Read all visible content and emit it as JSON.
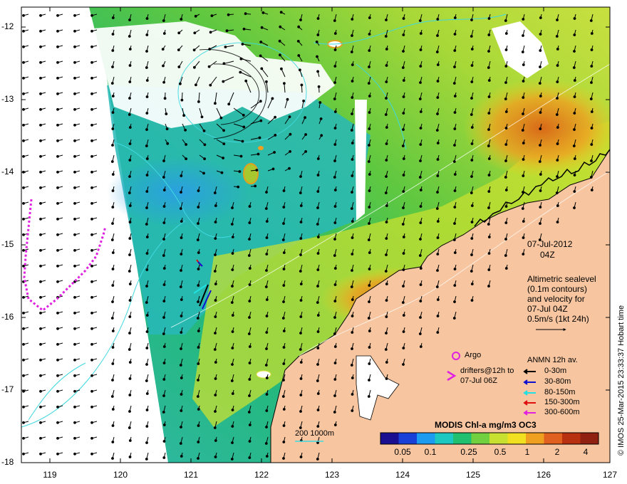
{
  "axes": {
    "y_ticks": [
      "-12",
      "-13",
      "-14",
      "-15",
      "-16",
      "-17",
      "-18"
    ],
    "x_ticks": [
      "119",
      "120",
      "121",
      "122",
      "123",
      "124",
      "125",
      "126",
      "127"
    ],
    "lon_range": [
      118.7,
      127
    ],
    "lat_range": [
      -18,
      -11.7
    ]
  },
  "date_block": {
    "date": "07-Jul-2012",
    "time": "04Z"
  },
  "altimetry_note": [
    "Altimetric sealevel",
    "(0.1m contours)",
    "and velocity for",
    "07-Jul 04Z",
    "0.5m/s (1kt 24h)"
  ],
  "argo_label": "Argo",
  "drifters_label": [
    "drifters@12h to",
    "07-Jul 06Z"
  ],
  "anmn": {
    "title": "ANMN 12h av.",
    "entries": [
      {
        "label": "0-30m",
        "color": "#000000"
      },
      {
        "label": "30-80m",
        "color": "#1010d0"
      },
      {
        "label": "80-150m",
        "color": "#20e0e0"
      },
      {
        "label": "150-300m",
        "color": "#e01010"
      },
      {
        "label": "300-600m",
        "color": "#e020e0"
      }
    ]
  },
  "colorbar": {
    "title": "MODIS Chl-a mg/m3 OC3",
    "ticks": [
      "0.05",
      "0.1",
      "0.25",
      "0.5",
      "1",
      "2",
      "4"
    ],
    "colors": [
      "#1a0f90",
      "#1840d8",
      "#1c9cf0",
      "#1cc8c0",
      "#20c070",
      "#70d040",
      "#c8e030",
      "#f0e020",
      "#f0a020",
      "#e06020",
      "#b83010",
      "#902010"
    ]
  },
  "depth_scale": "200  1000m",
  "side_credit": "© IMOS 25-Mar-2015 23:33:37 Hobart time",
  "colors": {
    "land": "#f7c6a0",
    "coast": "#000000",
    "contour": "#40d8e0",
    "argo": "#e020e0",
    "cloud": "#ffffff"
  }
}
